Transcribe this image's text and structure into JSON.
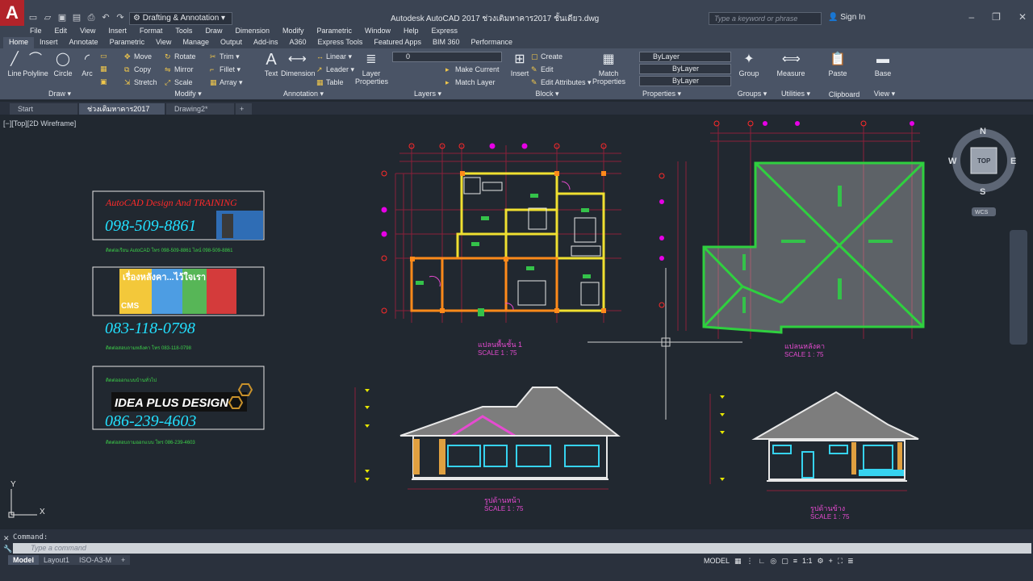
{
  "titlebar": {
    "workspace": "Drafting & Annotation",
    "window_title": "Autodesk AutoCAD 2017   ช่วงเติมหาคาร2017 ชั้นเดียว.dwg",
    "search_placeholder": "Type a keyword or phrase",
    "sign_in": "Sign In"
  },
  "menu": [
    "File",
    "Edit",
    "View",
    "Insert",
    "Format",
    "Tools",
    "Draw",
    "Dimension",
    "Modify",
    "Parametric",
    "Window",
    "Help",
    "Express"
  ],
  "ribbon_tabs": [
    "Home",
    "Insert",
    "Annotate",
    "Parametric",
    "View",
    "Manage",
    "Output",
    "Add-ins",
    "A360",
    "Express Tools",
    "Featured Apps",
    "BIM 360",
    "Performance"
  ],
  "ribbon": {
    "draw": {
      "title": "Draw",
      "line": "Line",
      "polyline": "Polyline",
      "circle": "Circle",
      "arc": "Arc"
    },
    "modify": {
      "title": "Modify",
      "move": "Move",
      "rotate": "Rotate",
      "trim": "Trim",
      "copy": "Copy",
      "mirror": "Mirror",
      "fillet": "Fillet",
      "stretch": "Stretch",
      "scale": "Scale",
      "array": "Array"
    },
    "annotation": {
      "title": "Annotation",
      "text": "Text",
      "dimension": "Dimension",
      "linear": "Linear",
      "leader": "Leader",
      "table": "Table"
    },
    "layers": {
      "title": "Layers",
      "layer_properties_1": "Layer",
      "layer_properties_2": "Properties",
      "current_layer": "0",
      "make_current": "Make Current",
      "match_layer": "Match Layer"
    },
    "block": {
      "title": "Block",
      "insert": "Insert",
      "create": "Create",
      "edit": "Edit",
      "edit_attributes": "Edit Attributes"
    },
    "properties": {
      "title": "Properties",
      "match_1": "Match",
      "match_2": "Properties",
      "color": "ByLayer",
      "linetype": "ByLayer",
      "lineweight": "ByLayer"
    },
    "groups": {
      "title": "Groups",
      "group": "Group"
    },
    "utilities": {
      "title": "Utilities",
      "measure": "Measure"
    },
    "clipboard": {
      "title": "Clipboard",
      "paste": "Paste"
    },
    "view": {
      "title": "View",
      "base": "Base"
    }
  },
  "doc_tabs": [
    "Start",
    "ช่วงเติมหาคาร2017 ชั้นเดียว",
    "Drawing2*"
  ],
  "viewport_label": "[−][Top][2D Wireframe]",
  "viewcube": {
    "n": "N",
    "s": "S",
    "e": "E",
    "w": "W",
    "top": "TOP",
    "wcs": "WCS"
  },
  "ads": {
    "ad1_title": "AutoCAD Design And TRAINING",
    "ad1_phone": "098-509-8861",
    "ad1_note": "ติดต่อเรียน AutoCAD โทร 098-509-8861 ไลน์ 098-509-8861",
    "ad2_banner": "เรื่องหลังคา...ไว้ใจเรา",
    "ad2_brand": "CMS",
    "ad2_phone": "083-118-0798",
    "ad2_note": "ติดต่อสอบถามหลังคา โทร 083-118-0798",
    "ad3_title": "ติดต่อออกแบบบ้านทั่วไป",
    "ad3_logo": "IDEA PLUS DESIGN",
    "ad3_phone": "086-239-4603",
    "ad3_note": "ติดต่อสอบถามออกแบบ โทร 086-239-4603"
  },
  "drawings": {
    "plan_title": "แปลนพื้นชั้น 1",
    "plan_scale": "SCALE 1 : 75",
    "roof_title": "แปลนหลังคา",
    "roof_scale": "SCALE 1 : 75",
    "front_title": "รูปด้านหน้า",
    "front_scale": "SCALE 1 : 75",
    "side_title": "รูปด้านข้าง",
    "side_scale": "SCALE 1 : 75"
  },
  "ucs": {
    "x": "X",
    "y": "Y"
  },
  "command": {
    "history": "Command:",
    "placeholder": "Type a command"
  },
  "layout_tabs": [
    "Model",
    "Layout1",
    "ISO-A3-M"
  ],
  "status": {
    "model": "MODEL",
    "scale": "1:1"
  },
  "colors": {
    "accent": "#b2232a",
    "canvas": "#212830",
    "ribbon": "#4a5466"
  }
}
